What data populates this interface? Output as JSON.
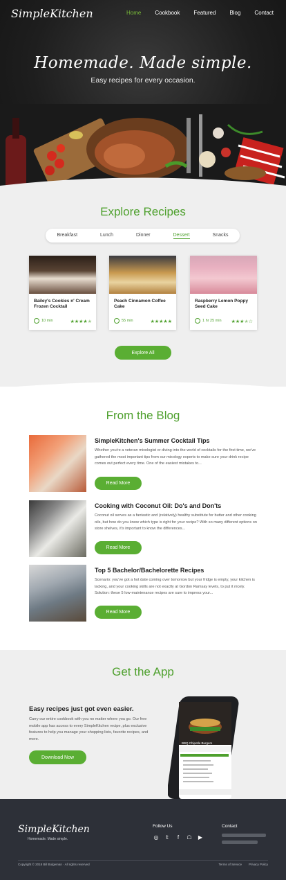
{
  "brand": {
    "logo": "SimpleKitchen",
    "tagline": "Homemade. Made simple."
  },
  "nav": {
    "items": [
      "Home",
      "Cookbook",
      "Featured",
      "Blog",
      "Contact"
    ],
    "active": "Home"
  },
  "hero": {
    "title": "Homemade. Made simple.",
    "subtitle": "Easy recipes for every occasion."
  },
  "explore": {
    "title": "Explore Recipes",
    "tabs": [
      "Breakfast",
      "Lunch",
      "Dinner",
      "Dessert",
      "Snacks"
    ],
    "active_tab": "Dessert",
    "cards": [
      {
        "name": "Bailey's Cookies n' Cream Frozen Cocktail",
        "time": "10 min",
        "rating": 4.5
      },
      {
        "name": "Peach Cinnamon Coffee Cake",
        "time": "55 min",
        "rating": 5
      },
      {
        "name": "Raspberry Lemon Poppy Seed Cake",
        "time": "1 hr 25 min",
        "rating": 3.5
      }
    ],
    "button": "Explore All"
  },
  "blog": {
    "title": "From the Blog",
    "posts": [
      {
        "title": "SimpleKitchen's Summer Cocktail Tips",
        "body": "Whether you're a veteran mixologist or diving into the world of cocktails for the first time, we've gathered the most important tips from our mixology experts to make sure your drink recipe comes out perfect every time. One of the easiest mistakes to...",
        "button": "Read More"
      },
      {
        "title": "Cooking with Coconut Oil: Do's and Don'ts",
        "body": "Coconut oil serves as a fantastic and (relatively) healthy substitute for butter and other cooking oils, but how do you know which type is right for your recipe? With so many different options on store shelves, it's important to know the differences...",
        "button": "Read More"
      },
      {
        "title": "Top 5 Bachelor/Bachelorette Recipes",
        "body": "Scenario: you've got a hot date coming over tomorrow but your fridge is empty, your kitchen is lacking, and your cooking skills are not exactly at Gordon Ramsay levels, to put it nicely. Solution: these 5 low-maintenance recipes are sure to impress your...",
        "button": "Read More"
      }
    ]
  },
  "app": {
    "title": "Get the App",
    "subtitle": "Easy recipes just got even easier.",
    "body": "Carry our entire cookbook with you no matter where you go. Our free mobile app has access to every SimpleKitchen recipe, plus exclusive features to help you manage your shopping lists, favorite recipes, and more.",
    "button": "Download Now",
    "phone_recipe": "BBQ Chipotle Burgers"
  },
  "footer": {
    "follow": "Follow Us",
    "social_icons": [
      "instagram-icon",
      "twitter-icon",
      "facebook-icon",
      "snapchat-icon",
      "youtube-icon"
    ],
    "contact": "Contact",
    "copyright": "Copyright © 2018 Bill Bolgeman  ·  All rights reserved",
    "links": [
      "Terms of Service",
      "Privacy Policy"
    ]
  },
  "colors": {
    "accent": "#5aae33",
    "footer": "#2d3038",
    "hero": "#1e1e1e"
  }
}
